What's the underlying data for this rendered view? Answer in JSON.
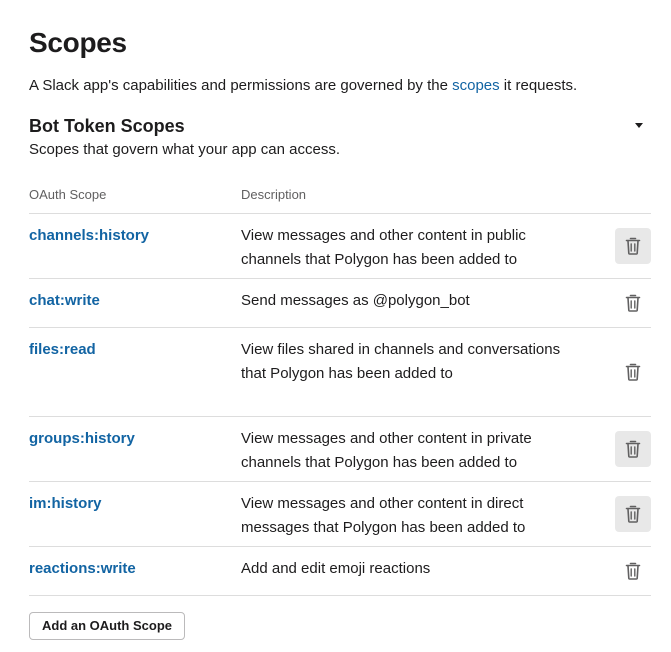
{
  "page": {
    "title": "Scopes",
    "intro_before": "A Slack app's capabilities and permissions are governed by the ",
    "intro_link": "scopes",
    "intro_after": " it requests."
  },
  "section": {
    "title": "Bot Token Scopes",
    "subtitle": "Scopes that govern what your app can access.",
    "caret_icon": "caret-down-icon"
  },
  "table": {
    "headers": {
      "scope": "OAuth Scope",
      "description": "Description"
    },
    "rows": [
      {
        "scope": "channels:history",
        "description": "View messages and other content in public channels that Polygon has been added to",
        "trash_highlighted": true
      },
      {
        "scope": "chat:write",
        "description": "Send messages as @polygon_bot",
        "trash_highlighted": false
      },
      {
        "scope": "files:read",
        "description": "View files shared in channels and conversations that Polygon has been added to",
        "trash_highlighted": false
      },
      {
        "scope": "groups:history",
        "description": "View messages and other content in private channels that Polygon has been added to",
        "trash_highlighted": true
      },
      {
        "scope": "im:history",
        "description": "View messages and other content in direct messages that Polygon has been added to",
        "trash_highlighted": true
      },
      {
        "scope": "reactions:write",
        "description": "Add and edit emoji reactions",
        "trash_highlighted": false
      }
    ],
    "trash_icon": "trash-icon"
  },
  "add_button": {
    "label": "Add an OAuth Scope"
  },
  "colors": {
    "link": "#1264a3",
    "text": "#1d1c1d",
    "muted": "#616061",
    "divider": "#dddddd",
    "trash_highlight": "#e8e8e8"
  }
}
